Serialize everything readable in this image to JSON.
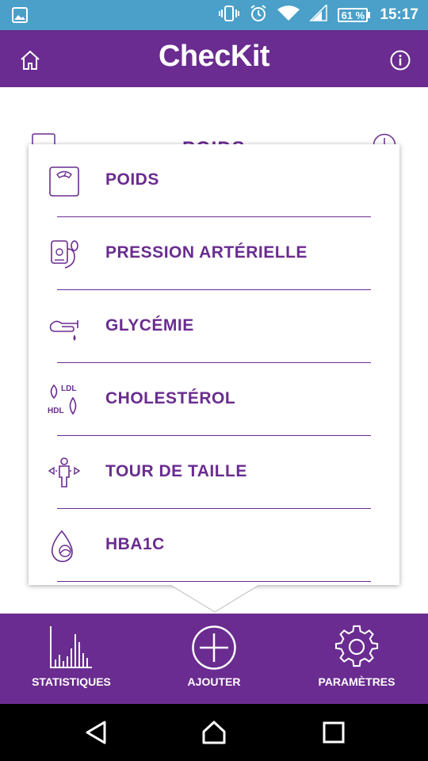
{
  "status_bar": {
    "battery_percent": "61 %",
    "time": "15:17",
    "icons": [
      "image-icon",
      "vibrate-icon",
      "alarm-icon",
      "wifi-icon",
      "signal-icon",
      "battery-icon"
    ]
  },
  "app_bar": {
    "title": "ChecKit",
    "icons": [
      "home-icon",
      "info-icon"
    ]
  },
  "background": {
    "section_title": "POIDS"
  },
  "dropdown": {
    "items": [
      {
        "label": "POIDS",
        "icon": "scale-icon"
      },
      {
        "label": "PRESSION ARTÉRIELLE",
        "icon": "blood-pressure-icon"
      },
      {
        "label": "GLYCÉMIE",
        "icon": "finger-drop-icon"
      },
      {
        "label": "CHOLESTÉROL",
        "icon": "cholesterol-icon",
        "icon_text": [
          "LDL",
          "HDL"
        ]
      },
      {
        "label": "TOUR DE TAILLE",
        "icon": "waist-icon"
      },
      {
        "label": "HBA1C",
        "icon": "hba1c-icon"
      }
    ]
  },
  "bottom_nav": {
    "items": [
      {
        "label": "STATISTIQUES",
        "icon": "chart-icon"
      },
      {
        "label": "AJOUTER",
        "icon": "plus-circle-icon"
      },
      {
        "label": "PARAMÈTRES",
        "icon": "gear-icon"
      }
    ]
  },
  "colors": {
    "primary": "#6a2c90",
    "status_bar": "#4aa0c9",
    "system_nav": "#000000"
  }
}
